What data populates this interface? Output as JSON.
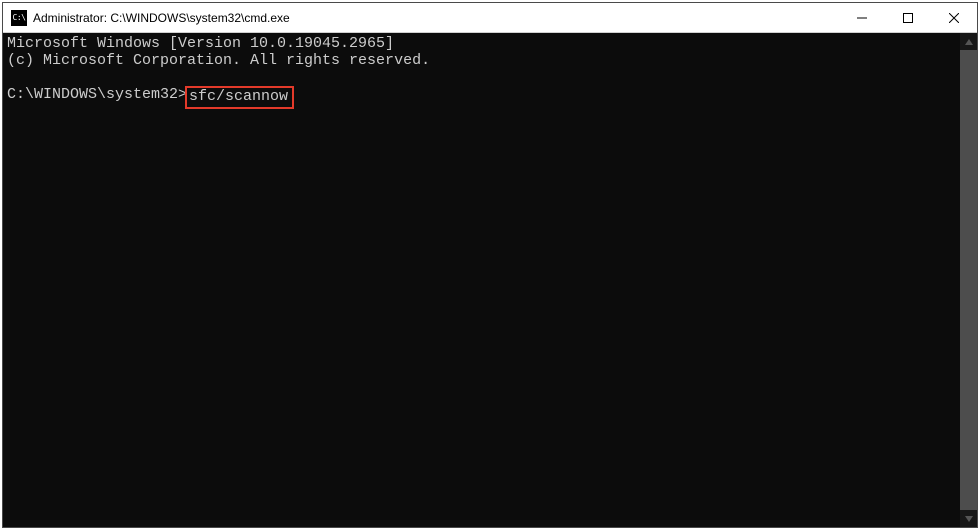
{
  "window": {
    "title": "Administrator: C:\\WINDOWS\\system32\\cmd.exe",
    "icon_label": "C:\\"
  },
  "terminal": {
    "line1": "Microsoft Windows [Version 10.0.19045.2965]",
    "line2": "(c) Microsoft Corporation. All rights reserved.",
    "prompt": "C:\\WINDOWS\\system32>",
    "command": "sfc/scannow"
  }
}
